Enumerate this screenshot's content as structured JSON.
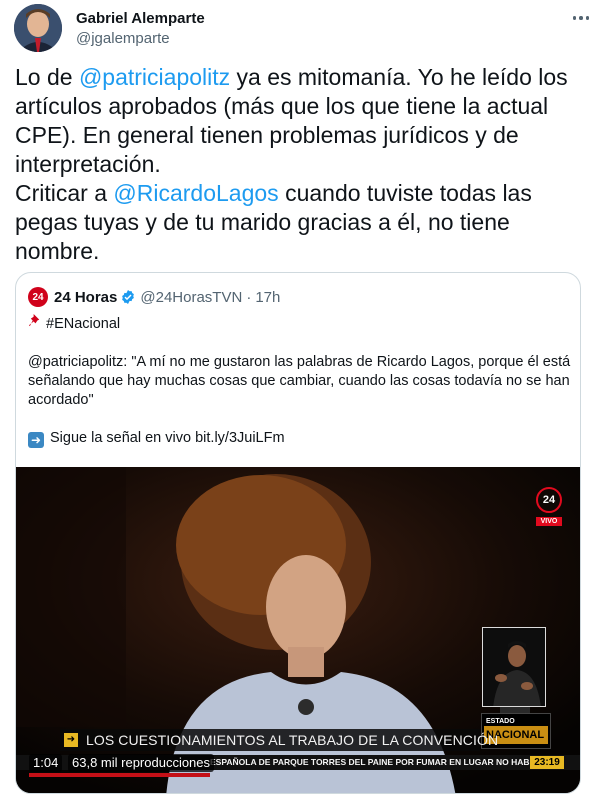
{
  "tweet": {
    "author_name": "Gabriel Alemparte",
    "author_handle": "@jgalemparte",
    "text": {
      "t1": "Lo de ",
      "m1": "@patriciapolitz",
      "t2": " ya es mitomanía. Yo he leído los artículos aprobados (más que los que tiene la actual CPE). En general tienen problemas jurídicos y de interpretación.",
      "t3": "Criticar a ",
      "m2": "@RicardoLagos",
      "t4": " cuando tuviste todas las pegas tuyas y de tu marido gracias a él, no tiene nombre."
    }
  },
  "quote": {
    "logo_text": "24",
    "name": "24 Horas",
    "handle": "@24HorasTVN",
    "separator": "·",
    "time": "17h",
    "hashtag": "#ENacional",
    "body": "@patriciapolitz: \"A mí no me gustaron las palabras de Ricardo Lagos, porque él está señalando que hay muchas cosas que cambiar, cuando las cosas todavía no se han acordado\"",
    "link_prefix": "Sigue la señal en vivo",
    "link": "bit.ly/3JuiLFm"
  },
  "video": {
    "logo": "24",
    "live": "VIVO",
    "estado_top": "ESTADO",
    "estado_main": "NACIONAL",
    "headline": "LOS CUESTIONAMIENTOS AL TRABAJO DE LA CONVENCIÓN",
    "ticker": "ESPAÑOLA DE PARQUE TORRES DEL PAINE POR FUMAR EN LUGAR NO HABILITADO",
    "clock": "23:19",
    "elapsed": "1:04",
    "views": "63,8 mil reproducciones",
    "progress_fraction": 0.32
  },
  "colors": {
    "accent": "#1d9bf0",
    "text": "#0f1419",
    "muted": "#536471",
    "border": "#cfd9de",
    "brand_red": "#d0021b",
    "estado_gold": "#c98e13"
  },
  "icons": {
    "more": "more-horizontal-icon",
    "verified": "verified-badge-icon",
    "pin": "pushpin-icon",
    "arrow": "right-arrow-icon"
  }
}
